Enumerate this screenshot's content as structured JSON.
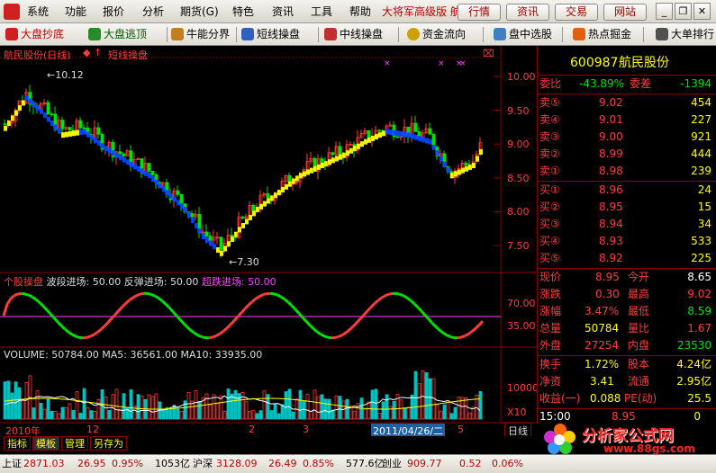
{
  "menubar": {
    "items": [
      "系统",
      "功能",
      "报价",
      "分析",
      "期货(G)",
      "特色",
      "资讯",
      "工具",
      "帮助"
    ],
    "brand": "大将军高级版",
    "brand_tail": "航",
    "buttons": [
      "行情",
      "资讯",
      "交易",
      "网站"
    ]
  },
  "toolbar": {
    "items": [
      {
        "label": "大盘抄底",
        "color": "#c00000"
      },
      {
        "label": "大盘逃顶",
        "color": "#006000"
      },
      {
        "label": "牛能分界",
        "color": "#000000"
      },
      {
        "label": "短线操盘",
        "color": "#000000"
      },
      {
        "label": "中线操盘",
        "color": "#000000"
      },
      {
        "label": "资金流向",
        "color": "#000000"
      },
      {
        "label": "盘中选股",
        "color": "#000000"
      },
      {
        "label": "热点掘金",
        "color": "#000000"
      },
      {
        "label": "大单排行",
        "color": "#000000"
      }
    ]
  },
  "chart": {
    "title": "航民股份(日线)",
    "indicator": "短线操盘",
    "price_axis": [
      "10.00",
      "9.50",
      "9.00",
      "8.50",
      "8.00",
      "7.50"
    ],
    "high_label": "10.12",
    "low_label": "7.30",
    "osc": {
      "name": "个股操盘",
      "l1": "波段进场:",
      "v1": "50.00",
      "l2": "反弹进场:",
      "v2": "50.00",
      "l3": "超跌进场:",
      "v3": "50.00"
    },
    "osc_axis": [
      "70.00",
      "35.00"
    ],
    "volume": {
      "label": "VOLUME:",
      "vol": "50784.00",
      "ma5_label": "MA5:",
      "ma5": "36561.00",
      "ma10_label": "MA10:",
      "ma10": "33935.00"
    },
    "vol_axis": [
      "10000",
      "X10"
    ],
    "date_axis": [
      "2010年",
      "12",
      "2",
      "3",
      "2011/04/26/二",
      "5"
    ],
    "period": "日线"
  },
  "quote": {
    "code": "600987",
    "name": "航民股份",
    "weibi_label": "委比",
    "weibi": "-43.89%",
    "weicha_label": "委差",
    "weicha": "-1394",
    "sell": [
      {
        "label": "卖⑤",
        "price": "9.02",
        "vol": "454"
      },
      {
        "label": "卖④",
        "price": "9.01",
        "vol": "227"
      },
      {
        "label": "卖③",
        "price": "9.00",
        "vol": "921"
      },
      {
        "label": "卖②",
        "price": "8.99",
        "vol": "444"
      },
      {
        "label": "卖①",
        "price": "8.98",
        "vol": "239"
      }
    ],
    "buy": [
      {
        "label": "买①",
        "price": "8.96",
        "vol": "24"
      },
      {
        "label": "买②",
        "price": "8.95",
        "vol": "15"
      },
      {
        "label": "买③",
        "price": "8.94",
        "vol": "34"
      },
      {
        "label": "买④",
        "price": "8.93",
        "vol": "533"
      },
      {
        "label": "买⑤",
        "price": "8.92",
        "vol": "225"
      }
    ],
    "stats": [
      {
        "l1": "现价",
        "v1": "8.95",
        "c1": "red",
        "l2": "今开",
        "v2": "8.65",
        "c2": "wht"
      },
      {
        "l1": "涨跌",
        "v1": "0.30",
        "c1": "red",
        "l2": "最高",
        "v2": "9.02",
        "c2": "red"
      },
      {
        "l1": "涨幅",
        "v1": "3.47%",
        "c1": "red",
        "l2": "最低",
        "v2": "8.59",
        "c2": "grn"
      },
      {
        "l1": "总量",
        "v1": "50784",
        "c1": "yel",
        "l2": "量比",
        "v2": "1.67",
        "c2": "red"
      },
      {
        "l1": "外盘",
        "v1": "27254",
        "c1": "red",
        "l2": "内盘",
        "v2": "23530",
        "c2": "grn"
      }
    ],
    "stats2": [
      {
        "l1": "换手",
        "v1": "1.72%",
        "l2": "股本",
        "v2": "4.24亿"
      },
      {
        "l1": "净资",
        "v1": "3.41",
        "l2": "流通",
        "v2": "2.95亿"
      },
      {
        "l1": "收益(一)",
        "v1": "0.088",
        "l2": "PE(动)",
        "v2": "25.5"
      }
    ],
    "tick": {
      "time": "15:00",
      "price": "8.95",
      "vol": "0"
    }
  },
  "tabs": [
    "指标",
    "模板",
    "管理",
    "另存为"
  ],
  "statusbar": {
    "sh_label": "上证",
    "sh_val": "2871.03",
    "sh_chg": "26.95",
    "sh_pct": "0.95%",
    "sh_amt": "1053亿",
    "sz_label": "沪深",
    "sz_val": "3128.09",
    "sz_chg": "26.49",
    "sz_pct": "0.85%",
    "sz_amt": "577.6亿",
    "cy_label": "创业",
    "cy_val": "909.77",
    "cy_chg": "0.52",
    "cy_pct": "0.06%"
  },
  "watermark": {
    "title": "分析家公式网",
    "url": "www.88gs.com"
  },
  "colors": {
    "up": "#ff3b3b",
    "down": "#00e000",
    "bull": "#ffff00",
    "bear": "#0044ff",
    "axis": "#8b0000"
  }
}
